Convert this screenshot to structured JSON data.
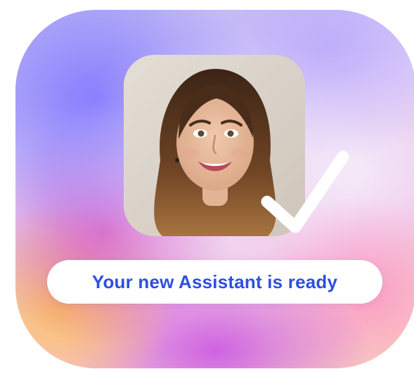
{
  "status_message": "Your new Assistant is ready",
  "colors": {
    "message_text": "#2f4fe0",
    "badge_background": "#ffffff",
    "checkmark": "#ffffff"
  },
  "icons": {
    "checkmark": "checkmark-icon"
  }
}
